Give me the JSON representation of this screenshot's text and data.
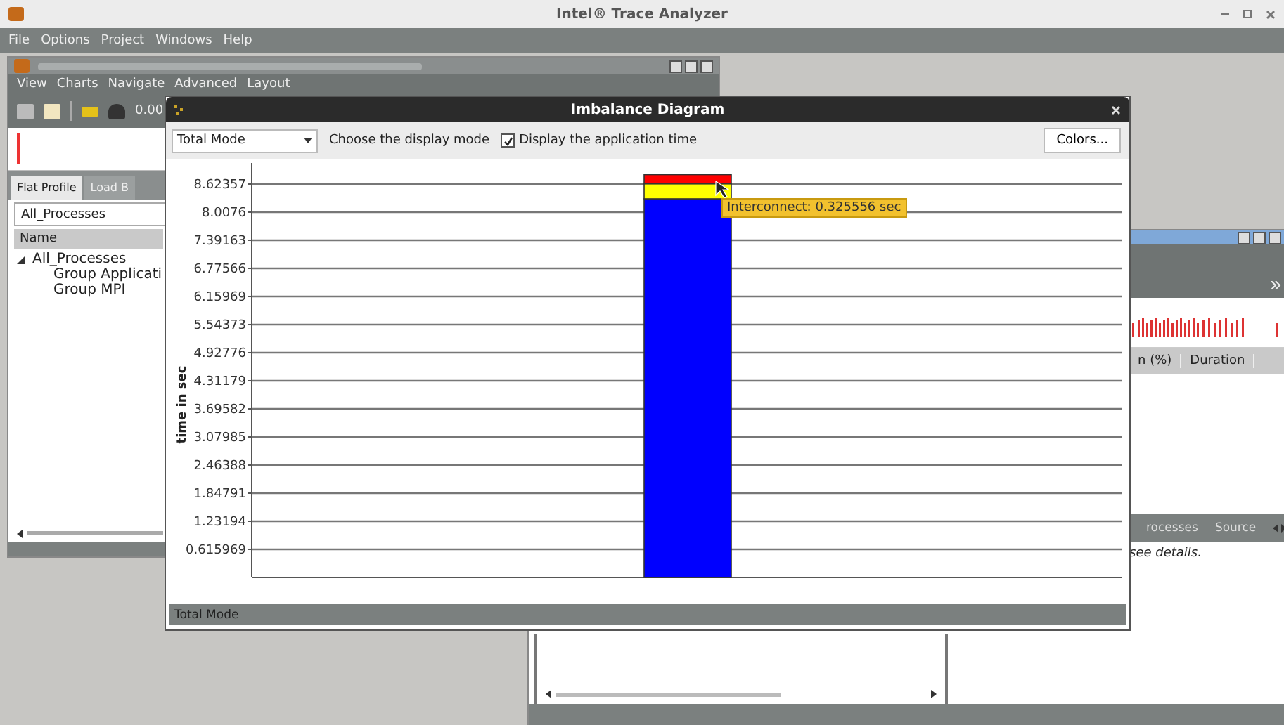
{
  "window": {
    "title": "Intel® Trace Analyzer"
  },
  "menu": [
    "File",
    "Options",
    "Project",
    "Windows",
    "Help"
  ],
  "trace_window": {
    "menu": [
      "View",
      "Charts",
      "Navigate",
      "Advanced",
      "Layout"
    ],
    "toolbar_value": "0.00",
    "tabs": [
      {
        "label": "Flat Profile",
        "selected": true
      },
      {
        "label": "Load B",
        "selected": false
      }
    ],
    "group_select": "All_Processes",
    "tree_header": "Name",
    "tree": [
      {
        "label": "All_Processes",
        "expanded": true,
        "children": [
          {
            "label": "Group Applicati"
          },
          {
            "label": "Group MPI"
          }
        ]
      }
    ]
  },
  "event_window": {
    "columns": [
      "n (%)",
      "Duration"
    ],
    "tabs": [
      "rocesses",
      "Source"
    ],
    "message": "see details."
  },
  "dialog": {
    "title": "Imbalance Diagram",
    "mode_select": "Total Mode",
    "mode_label": "Choose the display mode",
    "app_time": {
      "label": "Display the application time",
      "checked": true
    },
    "colors_button": "Colors...",
    "tooltip": "Interconnect: 0.325556 sec",
    "chart_data": {
      "type": "bar",
      "ylabel": "time in sec",
      "stacked": true,
      "grid": true,
      "ylim": [
        0,
        9.085
      ],
      "yticks": [
        0.615969,
        1.23194,
        1.84791,
        2.46388,
        3.07985,
        3.69582,
        4.31179,
        4.92776,
        5.54373,
        6.15969,
        6.77566,
        7.39163,
        8.0076,
        8.62357
      ],
      "series": [
        {
          "color": "#0000ff",
          "values": [
            8.3
          ]
        },
        {
          "color": "#ffff00",
          "values": [
            0.33
          ]
        },
        {
          "color": "#ff0000",
          "values": [
            0.2
          ]
        }
      ]
    },
    "status": "Total Mode"
  }
}
